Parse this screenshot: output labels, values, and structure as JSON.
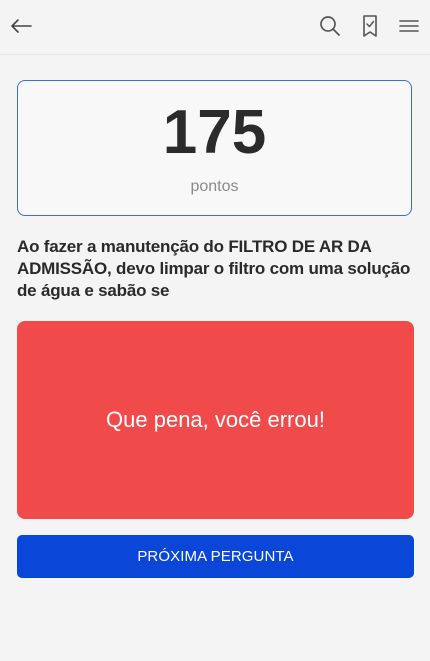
{
  "header": {
    "icons": [
      "back-arrow-icon",
      "search-icon",
      "bookmark-check-icon",
      "menu-icon"
    ]
  },
  "score": {
    "value": "175",
    "unit": "pontos"
  },
  "question": {
    "text": "Ao fazer a manutenção do FILTRO DE AR DA ADMISSÃO, devo limpar o filtro com uma solução de água e sabão se"
  },
  "result": {
    "message": "Que pena, você errou!",
    "color": "#f14a4a"
  },
  "actions": {
    "next_label": "PRÓXIMA PERGUNTA",
    "next_color": "#0a47d8"
  },
  "colors": {
    "accent_border": "#3b6fd6",
    "background": "#f4f4f4"
  }
}
